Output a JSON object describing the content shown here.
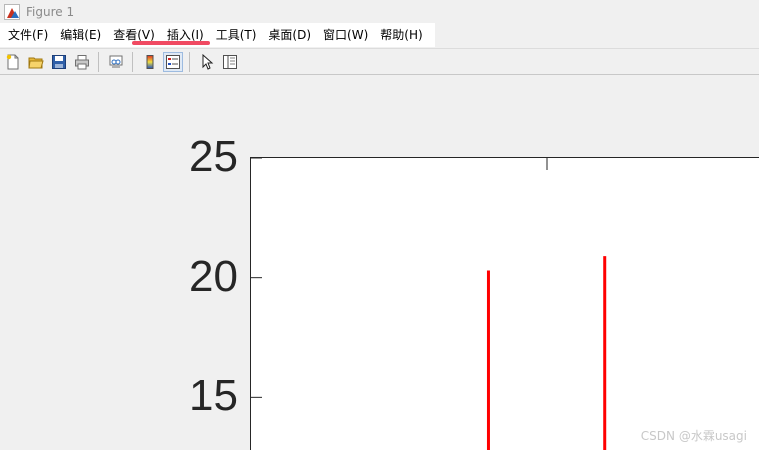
{
  "window": {
    "title": "Figure 1",
    "icon": "matlab-icon"
  },
  "menu": {
    "items": [
      {
        "label": "文件(F)",
        "name": "menu-file"
      },
      {
        "label": "编辑(E)",
        "name": "menu-edit"
      },
      {
        "label": "查看(V)",
        "name": "menu-view"
      },
      {
        "label": "插入(I)",
        "name": "menu-insert"
      },
      {
        "label": "工具(T)",
        "name": "menu-tools"
      },
      {
        "label": "桌面(D)",
        "name": "menu-desktop"
      },
      {
        "label": "窗口(W)",
        "name": "menu-window"
      },
      {
        "label": "帮助(H)",
        "name": "menu-help"
      }
    ],
    "highlight_color": "#f04a62"
  },
  "toolbar": {
    "buttons": [
      {
        "icon": "new-figure-icon"
      },
      {
        "icon": "open-folder-icon"
      },
      {
        "icon": "save-icon"
      },
      {
        "icon": "print-icon"
      },
      {
        "icon": "link-plot-icon"
      },
      {
        "icon": "colorbar-icon"
      },
      {
        "icon": "legend-icon",
        "active": true
      },
      {
        "icon": "pointer-icon"
      },
      {
        "icon": "property-editor-icon"
      }
    ]
  },
  "chart_data": {
    "type": "bar",
    "ytick_labels": [
      "25",
      "20",
      "15"
    ],
    "yticks": [
      25,
      20,
      15
    ],
    "ylim_visible": [
      12.8,
      25
    ],
    "series": [
      {
        "color": "#ff0000",
        "stems": [
          {
            "position": 0.4685,
            "top": 20.3
          },
          {
            "position": 0.6969,
            "top": 20.9
          }
        ]
      }
    ]
  },
  "watermark": "CSDN @水霖usagi"
}
